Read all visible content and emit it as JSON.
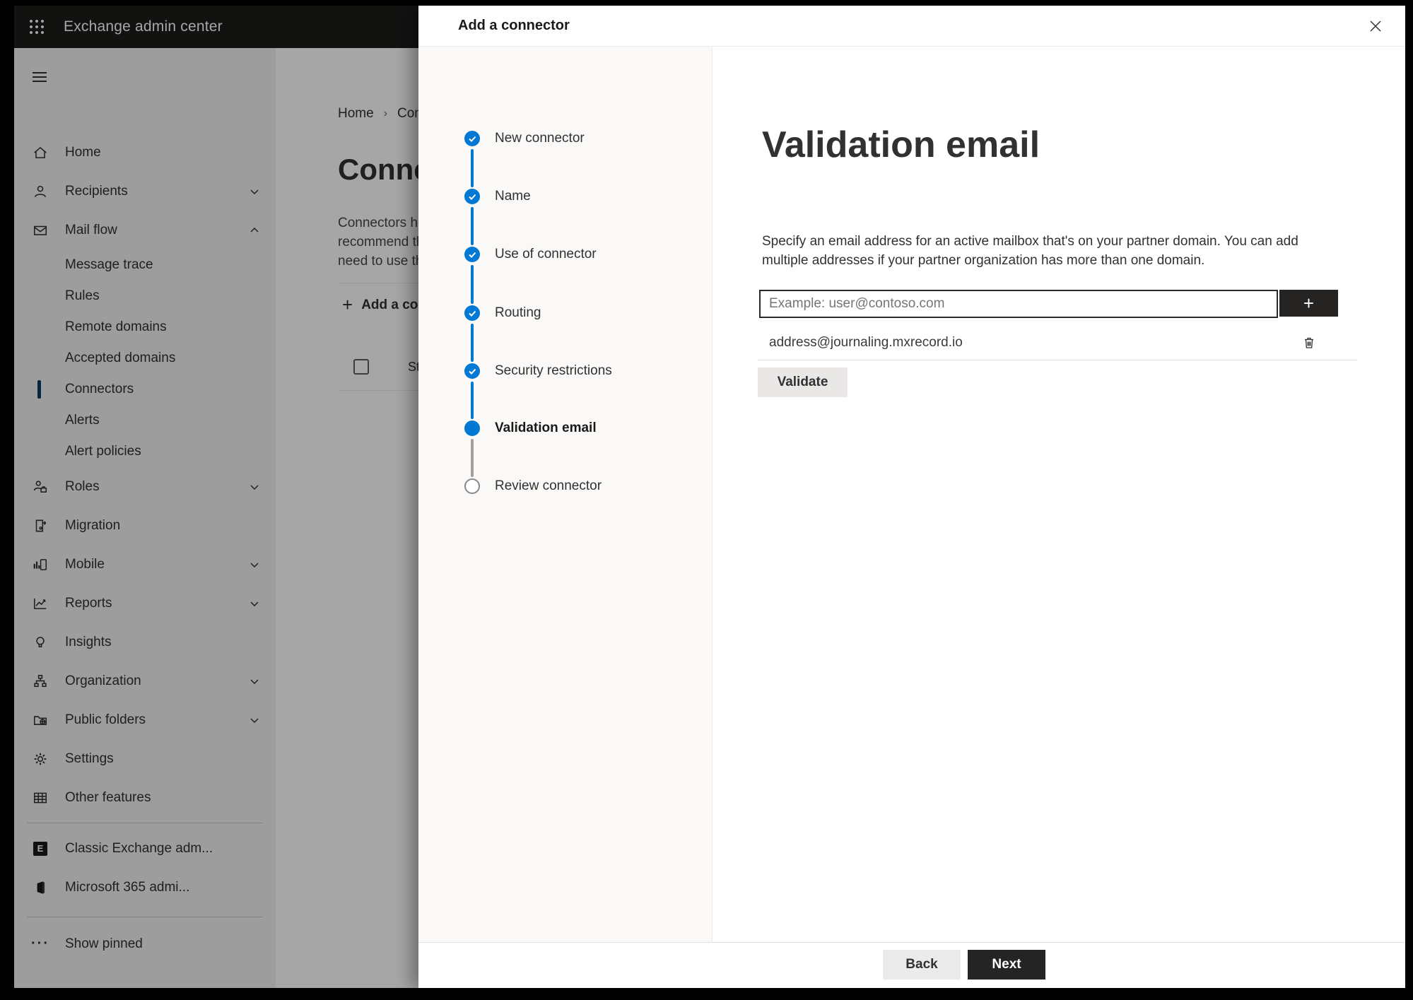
{
  "colors": {
    "accent": "#0078d4",
    "dark_button": "#252423",
    "selected_indicator": "#0078d4"
  },
  "app": {
    "title": "Exchange admin center"
  },
  "sidebar": {
    "items": [
      {
        "label": "Home",
        "icon": "home-icon",
        "type": "top"
      },
      {
        "label": "Recipients",
        "icon": "person-icon",
        "type": "top",
        "chevron": "down"
      },
      {
        "label": "Mail flow",
        "icon": "mail-icon",
        "type": "top",
        "chevron": "up",
        "expanded": true
      },
      {
        "label": "Message trace",
        "type": "sub"
      },
      {
        "label": "Rules",
        "type": "sub"
      },
      {
        "label": "Remote domains",
        "type": "sub"
      },
      {
        "label": "Accepted domains",
        "type": "sub"
      },
      {
        "label": "Connectors",
        "type": "sub",
        "selected": true
      },
      {
        "label": "Alerts",
        "type": "sub"
      },
      {
        "label": "Alert policies",
        "type": "sub"
      },
      {
        "label": "Roles",
        "icon": "roles-icon",
        "type": "top",
        "chevron": "down"
      },
      {
        "label": "Migration",
        "icon": "migration-icon",
        "type": "top"
      },
      {
        "label": "Mobile",
        "icon": "mobile-icon",
        "type": "top",
        "chevron": "down"
      },
      {
        "label": "Reports",
        "icon": "reports-icon",
        "type": "top",
        "chevron": "down"
      },
      {
        "label": "Insights",
        "icon": "lightbulb-icon",
        "type": "top"
      },
      {
        "label": "Organization",
        "icon": "org-chart-icon",
        "type": "top",
        "chevron": "down"
      },
      {
        "label": "Public folders",
        "icon": "folder-globe-icon",
        "type": "top",
        "chevron": "down"
      },
      {
        "label": "Settings",
        "icon": "gear-icon",
        "type": "top"
      },
      {
        "label": "Other features",
        "icon": "table-icon",
        "type": "top"
      }
    ],
    "footer_items": [
      {
        "label": "Classic Exchange adm...",
        "icon": "exchange-logo-icon"
      },
      {
        "label": "Microsoft 365 admi...",
        "icon": "microsoft-365-icon"
      },
      {
        "label": "Show pinned",
        "icon": "ellipsis-icon"
      }
    ]
  },
  "main": {
    "breadcrumb": [
      "Home",
      "Conne"
    ],
    "heading": "Connec",
    "description_lines": [
      "Connectors help",
      "recommend that",
      "need to use ther"
    ],
    "add_button_label": "Add a conn",
    "table": {
      "status_header": "Status"
    }
  },
  "panel": {
    "title": "Add a connector",
    "steps": [
      {
        "label": "New connector",
        "state": "complete"
      },
      {
        "label": "Name",
        "state": "complete"
      },
      {
        "label": "Use of connector",
        "state": "complete"
      },
      {
        "label": "Routing",
        "state": "complete"
      },
      {
        "label": "Security restrictions",
        "state": "complete"
      },
      {
        "label": "Validation email",
        "state": "active"
      },
      {
        "label": "Review connector",
        "state": "upcoming"
      }
    ],
    "content": {
      "heading": "Validation email",
      "description": "Specify an email address for an active mailbox that's on your partner domain. You can add multiple addresses if your partner organization has more than one domain.",
      "email_input": {
        "placeholder": "Example: user@contoso.com",
        "value": ""
      },
      "add_address_label": "+",
      "addresses": [
        "address@journaling.mxrecord.io"
      ],
      "validate_label": "Validate"
    },
    "footer": {
      "back_label": "Back",
      "next_label": "Next"
    }
  }
}
